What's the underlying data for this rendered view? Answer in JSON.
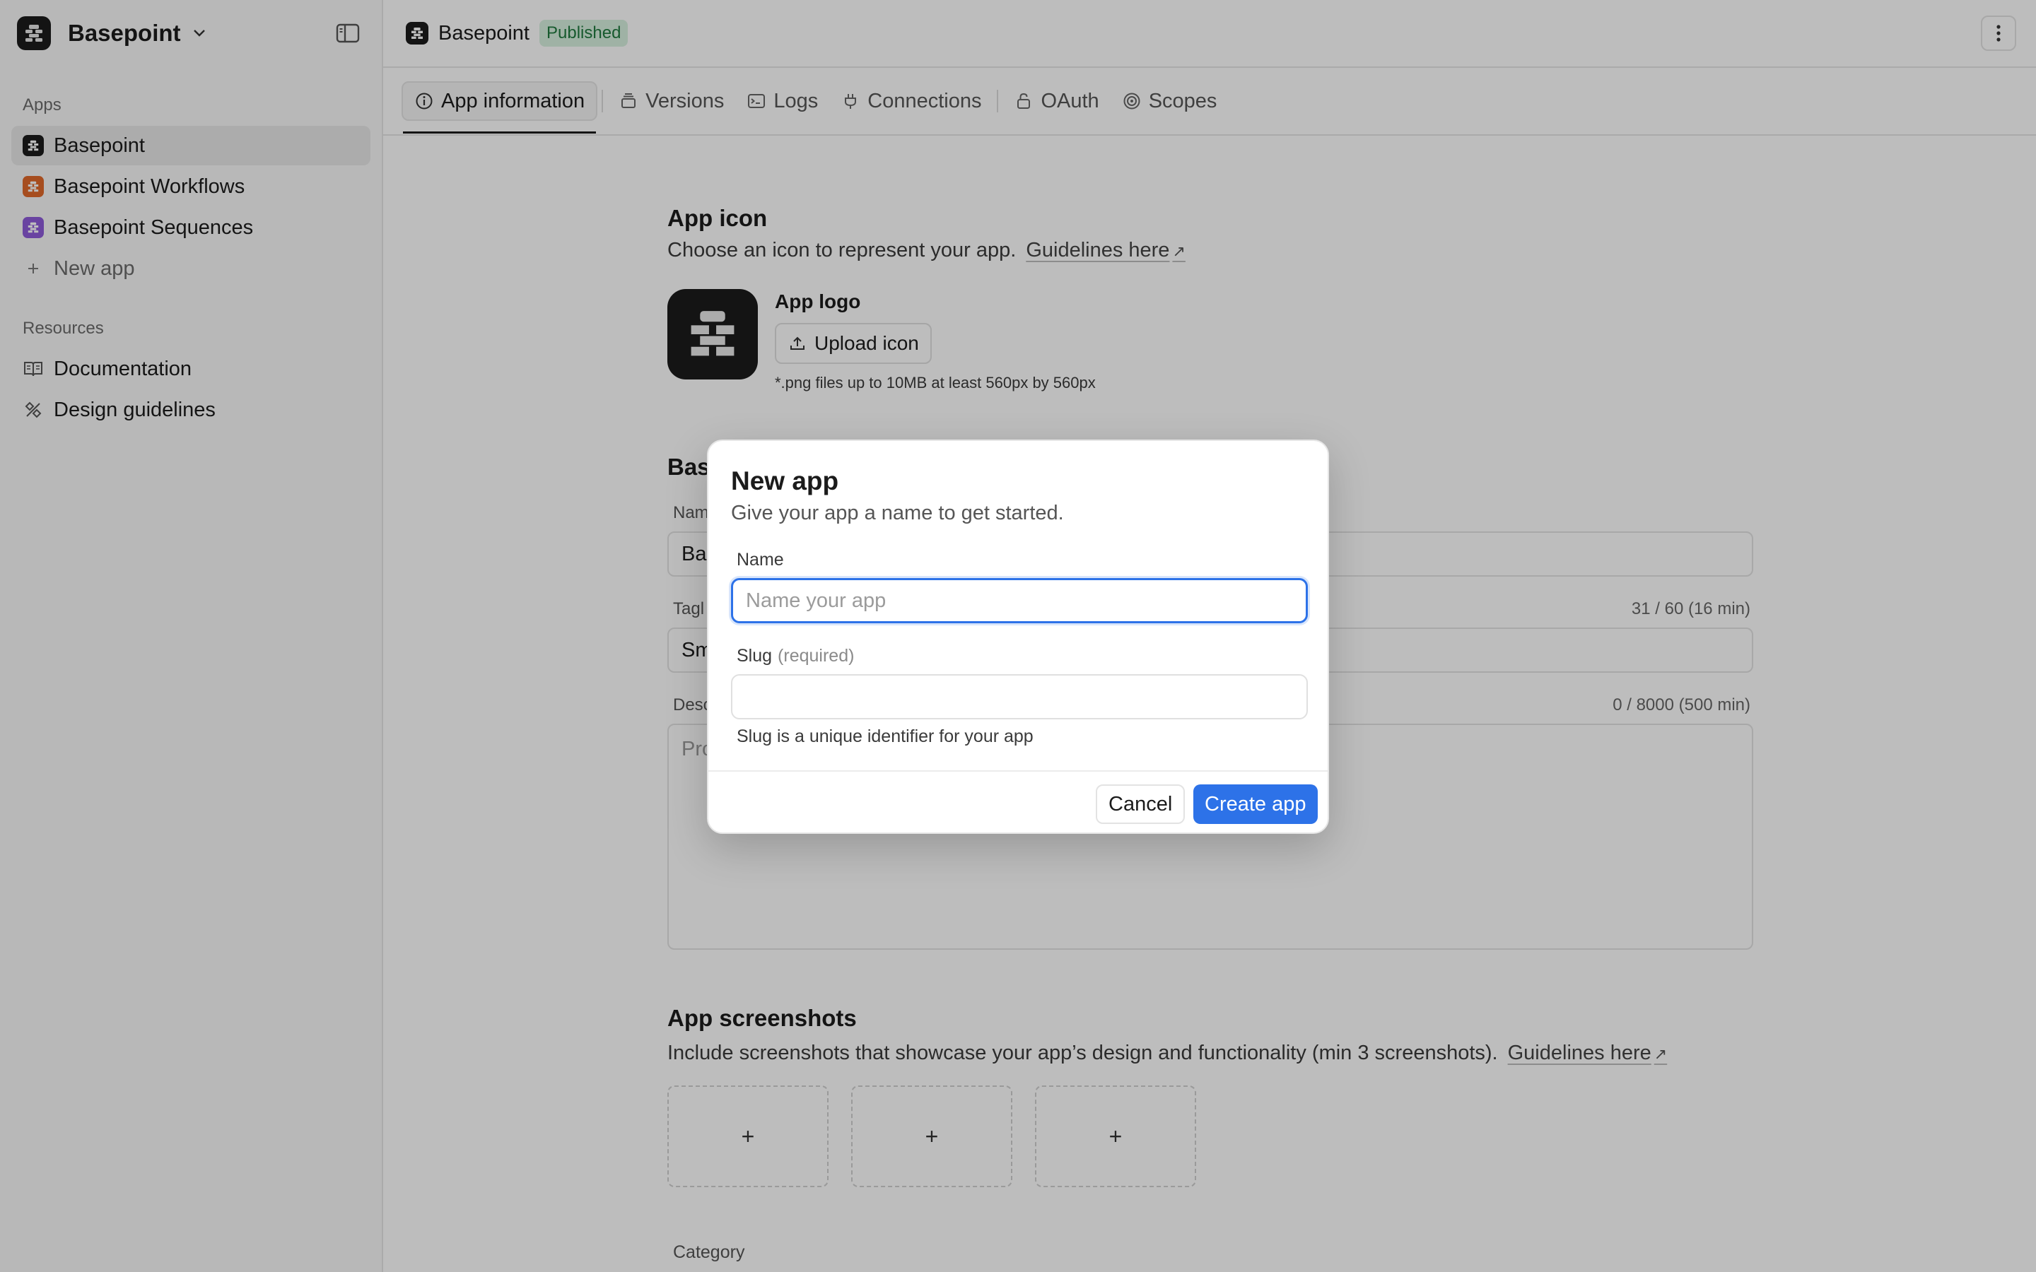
{
  "workspace": {
    "name": "Basepoint"
  },
  "sidebar": {
    "apps_label": "Apps",
    "apps": [
      {
        "label": "Basepoint",
        "color": "#1b1b1b"
      },
      {
        "label": "Basepoint Workflows",
        "color": "#e0692a"
      },
      {
        "label": "Basepoint Sequences",
        "color": "#8e5bd9"
      }
    ],
    "new_app_label": "New app",
    "resources_label": "Resources",
    "resources": [
      {
        "label": "Documentation",
        "icon": "book-icon"
      },
      {
        "label": "Design guidelines",
        "icon": "design-tools-icon"
      }
    ]
  },
  "topbar": {
    "title": "Basepoint",
    "status": "Published"
  },
  "tabs": [
    {
      "label": "App information",
      "icon": "info-icon"
    },
    {
      "label": "Versions",
      "icon": "layers-icon"
    },
    {
      "label": "Logs",
      "icon": "terminal-icon"
    },
    {
      "label": "Connections",
      "icon": "plug-icon"
    },
    {
      "label": "OAuth",
      "icon": "lock-icon"
    },
    {
      "label": "Scopes",
      "icon": "target-icon"
    }
  ],
  "app_icon": {
    "title": "App icon",
    "subtitle": "Choose an icon to represent your app.",
    "guidelines_link": "Guidelines here",
    "logo_label": "App logo",
    "upload_label": "Upload icon",
    "hint": "*.png files up to 10MB at least 560px by 560px"
  },
  "basic_info": {
    "title_partial": "Bas",
    "name_label_partial": "Nam",
    "name_value_partial": "Bas",
    "tagline_label_partial": "Tagl",
    "tagline_value_partial": "Sm",
    "tagline_counter": "31 / 60 (16 min)",
    "description_label_partial": "Desc",
    "description_placeholder_partial": "Pro",
    "description_counter": "0 / 8000 (500 min)"
  },
  "screenshots": {
    "title": "App screenshots",
    "subtitle": "Include screenshots that showcase your app’s design and functionality (min 3 screenshots).",
    "guidelines_link": "Guidelines here",
    "slots": [
      "+",
      "+",
      "+"
    ]
  },
  "category_label": "Category",
  "modal": {
    "title": "New app",
    "subtitle": "Give your app a name to get started.",
    "name_label": "Name",
    "name_placeholder": "Name your app",
    "name_value": "",
    "slug_label": "Slug",
    "slug_required": "(required)",
    "slug_value": "",
    "slug_help": "Slug is a unique identifier for your app",
    "cancel_label": "Cancel",
    "create_label": "Create app",
    "accent_color": "#2d72e8"
  }
}
